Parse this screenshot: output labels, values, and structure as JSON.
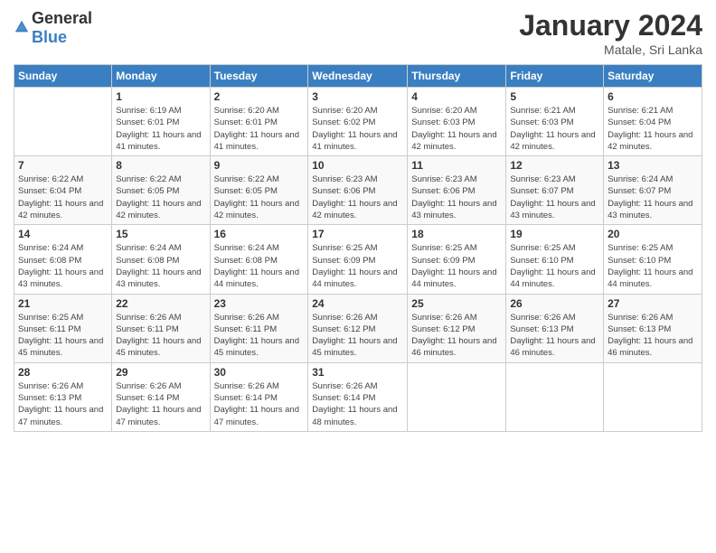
{
  "logo": {
    "general": "General",
    "blue": "Blue"
  },
  "title": "January 2024",
  "subtitle": "Matale, Sri Lanka",
  "weekdays": [
    "Sunday",
    "Monday",
    "Tuesday",
    "Wednesday",
    "Thursday",
    "Friday",
    "Saturday"
  ],
  "weeks": [
    [
      {
        "day": "",
        "sunrise": "",
        "sunset": "",
        "daylight": ""
      },
      {
        "day": "1",
        "sunrise": "Sunrise: 6:19 AM",
        "sunset": "Sunset: 6:01 PM",
        "daylight": "Daylight: 11 hours and 41 minutes."
      },
      {
        "day": "2",
        "sunrise": "Sunrise: 6:20 AM",
        "sunset": "Sunset: 6:01 PM",
        "daylight": "Daylight: 11 hours and 41 minutes."
      },
      {
        "day": "3",
        "sunrise": "Sunrise: 6:20 AM",
        "sunset": "Sunset: 6:02 PM",
        "daylight": "Daylight: 11 hours and 41 minutes."
      },
      {
        "day": "4",
        "sunrise": "Sunrise: 6:20 AM",
        "sunset": "Sunset: 6:03 PM",
        "daylight": "Daylight: 11 hours and 42 minutes."
      },
      {
        "day": "5",
        "sunrise": "Sunrise: 6:21 AM",
        "sunset": "Sunset: 6:03 PM",
        "daylight": "Daylight: 11 hours and 42 minutes."
      },
      {
        "day": "6",
        "sunrise": "Sunrise: 6:21 AM",
        "sunset": "Sunset: 6:04 PM",
        "daylight": "Daylight: 11 hours and 42 minutes."
      }
    ],
    [
      {
        "day": "7",
        "sunrise": "Sunrise: 6:22 AM",
        "sunset": "Sunset: 6:04 PM",
        "daylight": "Daylight: 11 hours and 42 minutes."
      },
      {
        "day": "8",
        "sunrise": "Sunrise: 6:22 AM",
        "sunset": "Sunset: 6:05 PM",
        "daylight": "Daylight: 11 hours and 42 minutes."
      },
      {
        "day": "9",
        "sunrise": "Sunrise: 6:22 AM",
        "sunset": "Sunset: 6:05 PM",
        "daylight": "Daylight: 11 hours and 42 minutes."
      },
      {
        "day": "10",
        "sunrise": "Sunrise: 6:23 AM",
        "sunset": "Sunset: 6:06 PM",
        "daylight": "Daylight: 11 hours and 42 minutes."
      },
      {
        "day": "11",
        "sunrise": "Sunrise: 6:23 AM",
        "sunset": "Sunset: 6:06 PM",
        "daylight": "Daylight: 11 hours and 43 minutes."
      },
      {
        "day": "12",
        "sunrise": "Sunrise: 6:23 AM",
        "sunset": "Sunset: 6:07 PM",
        "daylight": "Daylight: 11 hours and 43 minutes."
      },
      {
        "day": "13",
        "sunrise": "Sunrise: 6:24 AM",
        "sunset": "Sunset: 6:07 PM",
        "daylight": "Daylight: 11 hours and 43 minutes."
      }
    ],
    [
      {
        "day": "14",
        "sunrise": "Sunrise: 6:24 AM",
        "sunset": "Sunset: 6:08 PM",
        "daylight": "Daylight: 11 hours and 43 minutes."
      },
      {
        "day": "15",
        "sunrise": "Sunrise: 6:24 AM",
        "sunset": "Sunset: 6:08 PM",
        "daylight": "Daylight: 11 hours and 43 minutes."
      },
      {
        "day": "16",
        "sunrise": "Sunrise: 6:24 AM",
        "sunset": "Sunset: 6:08 PM",
        "daylight": "Daylight: 11 hours and 44 minutes."
      },
      {
        "day": "17",
        "sunrise": "Sunrise: 6:25 AM",
        "sunset": "Sunset: 6:09 PM",
        "daylight": "Daylight: 11 hours and 44 minutes."
      },
      {
        "day": "18",
        "sunrise": "Sunrise: 6:25 AM",
        "sunset": "Sunset: 6:09 PM",
        "daylight": "Daylight: 11 hours and 44 minutes."
      },
      {
        "day": "19",
        "sunrise": "Sunrise: 6:25 AM",
        "sunset": "Sunset: 6:10 PM",
        "daylight": "Daylight: 11 hours and 44 minutes."
      },
      {
        "day": "20",
        "sunrise": "Sunrise: 6:25 AM",
        "sunset": "Sunset: 6:10 PM",
        "daylight": "Daylight: 11 hours and 44 minutes."
      }
    ],
    [
      {
        "day": "21",
        "sunrise": "Sunrise: 6:25 AM",
        "sunset": "Sunset: 6:11 PM",
        "daylight": "Daylight: 11 hours and 45 minutes."
      },
      {
        "day": "22",
        "sunrise": "Sunrise: 6:26 AM",
        "sunset": "Sunset: 6:11 PM",
        "daylight": "Daylight: 11 hours and 45 minutes."
      },
      {
        "day": "23",
        "sunrise": "Sunrise: 6:26 AM",
        "sunset": "Sunset: 6:11 PM",
        "daylight": "Daylight: 11 hours and 45 minutes."
      },
      {
        "day": "24",
        "sunrise": "Sunrise: 6:26 AM",
        "sunset": "Sunset: 6:12 PM",
        "daylight": "Daylight: 11 hours and 45 minutes."
      },
      {
        "day": "25",
        "sunrise": "Sunrise: 6:26 AM",
        "sunset": "Sunset: 6:12 PM",
        "daylight": "Daylight: 11 hours and 46 minutes."
      },
      {
        "day": "26",
        "sunrise": "Sunrise: 6:26 AM",
        "sunset": "Sunset: 6:13 PM",
        "daylight": "Daylight: 11 hours and 46 minutes."
      },
      {
        "day": "27",
        "sunrise": "Sunrise: 6:26 AM",
        "sunset": "Sunset: 6:13 PM",
        "daylight": "Daylight: 11 hours and 46 minutes."
      }
    ],
    [
      {
        "day": "28",
        "sunrise": "Sunrise: 6:26 AM",
        "sunset": "Sunset: 6:13 PM",
        "daylight": "Daylight: 11 hours and 47 minutes."
      },
      {
        "day": "29",
        "sunrise": "Sunrise: 6:26 AM",
        "sunset": "Sunset: 6:14 PM",
        "daylight": "Daylight: 11 hours and 47 minutes."
      },
      {
        "day": "30",
        "sunrise": "Sunrise: 6:26 AM",
        "sunset": "Sunset: 6:14 PM",
        "daylight": "Daylight: 11 hours and 47 minutes."
      },
      {
        "day": "31",
        "sunrise": "Sunrise: 6:26 AM",
        "sunset": "Sunset: 6:14 PM",
        "daylight": "Daylight: 11 hours and 48 minutes."
      },
      {
        "day": "",
        "sunrise": "",
        "sunset": "",
        "daylight": ""
      },
      {
        "day": "",
        "sunrise": "",
        "sunset": "",
        "daylight": ""
      },
      {
        "day": "",
        "sunrise": "",
        "sunset": "",
        "daylight": ""
      }
    ]
  ]
}
